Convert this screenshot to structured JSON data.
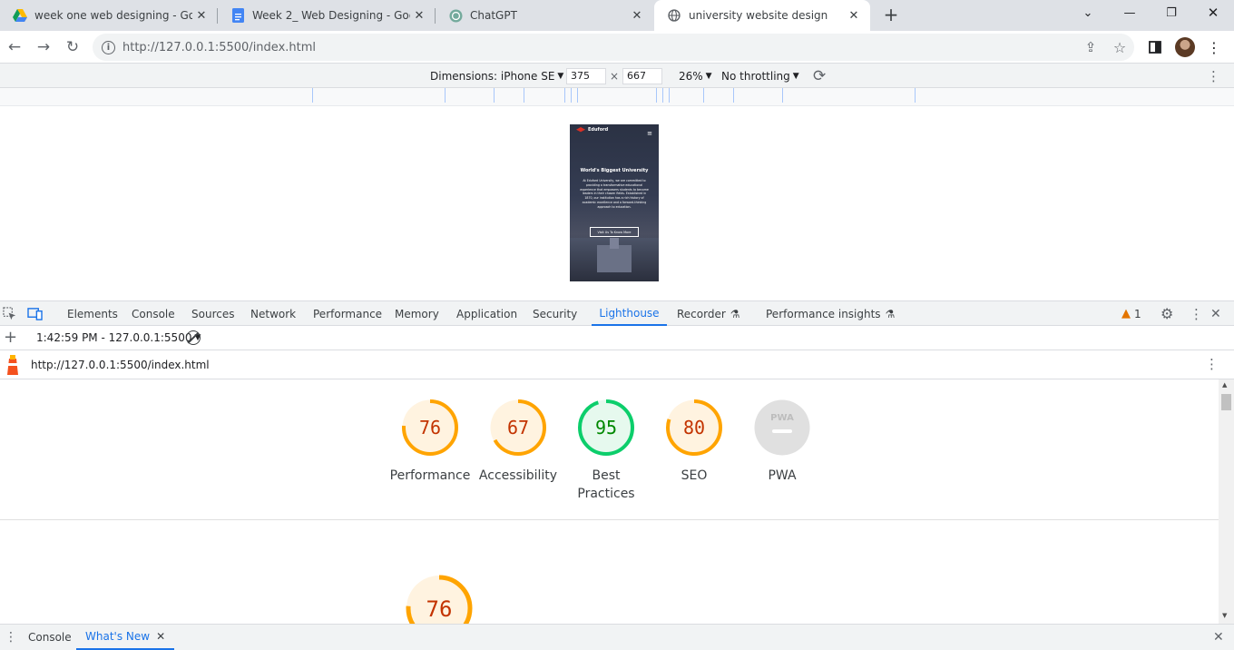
{
  "browser": {
    "tabs": [
      {
        "title": "week one web designing - Goog",
        "icon": "google-drive-icon"
      },
      {
        "title": "Week 2_ Web Designing - Goog",
        "icon": "google-docs-icon"
      },
      {
        "title": "ChatGPT",
        "icon": "chatgpt-icon"
      },
      {
        "title": "university website design",
        "icon": "globe-icon",
        "active": true
      }
    ],
    "url": "http://127.0.0.1:5500/index.html"
  },
  "device_toolbar": {
    "dimensions_label": "Dimensions: iPhone SE",
    "width": "375",
    "times": "×",
    "height": "667",
    "zoom": "26%",
    "throttling": "No throttling"
  },
  "site": {
    "brand": "Eduford",
    "heading": "World's Biggest University",
    "paragraph": "At Eduford University, we are committed to providing a transformative educational experience that empowers students to become leaders in their chosen fields. Established in 1870, our institution has a rich history of academic excellence and a forward-thinking approach to education.",
    "cta": "Visit Us To Know More"
  },
  "devtools": {
    "tabs": [
      "Elements",
      "Console",
      "Sources",
      "Network",
      "Performance",
      "Memory",
      "Application",
      "Security",
      "Lighthouse",
      "Recorder",
      "Performance insights"
    ],
    "active_tab": "Lighthouse",
    "warning_count": "1",
    "report_selector": "1:42:59 PM - 127.0.0.1:5500",
    "report_url": "http://127.0.0.1:5500/index.html",
    "scores": [
      {
        "label": "Performance",
        "value": "76",
        "fraction": 0.76,
        "color": "#ffa400",
        "text_color": "#c33300",
        "bg": "#fff3e0"
      },
      {
        "label": "Accessibility",
        "value": "67",
        "fraction": 0.67,
        "color": "#ffa400",
        "text_color": "#c33300",
        "bg": "#fff3e0"
      },
      {
        "label": "Best Practices",
        "value": "95",
        "fraction": 0.95,
        "color": "#0cce6b",
        "text_color": "#008800",
        "bg": "#e6f9ee"
      },
      {
        "label": "SEO",
        "value": "80",
        "fraction": 0.8,
        "color": "#ffa400",
        "text_color": "#c33300",
        "bg": "#fff3e0"
      },
      {
        "label": "PWA",
        "value": "PWA",
        "fraction": 0,
        "color": "#e0e0e0",
        "text_color": "#9e9e9e",
        "bg": "#e0e0e0"
      }
    ],
    "big_score": {
      "value": "76",
      "fraction": 0.76
    },
    "drawer_tabs": [
      "Console",
      "What's New"
    ],
    "drawer_active": "What's New"
  }
}
